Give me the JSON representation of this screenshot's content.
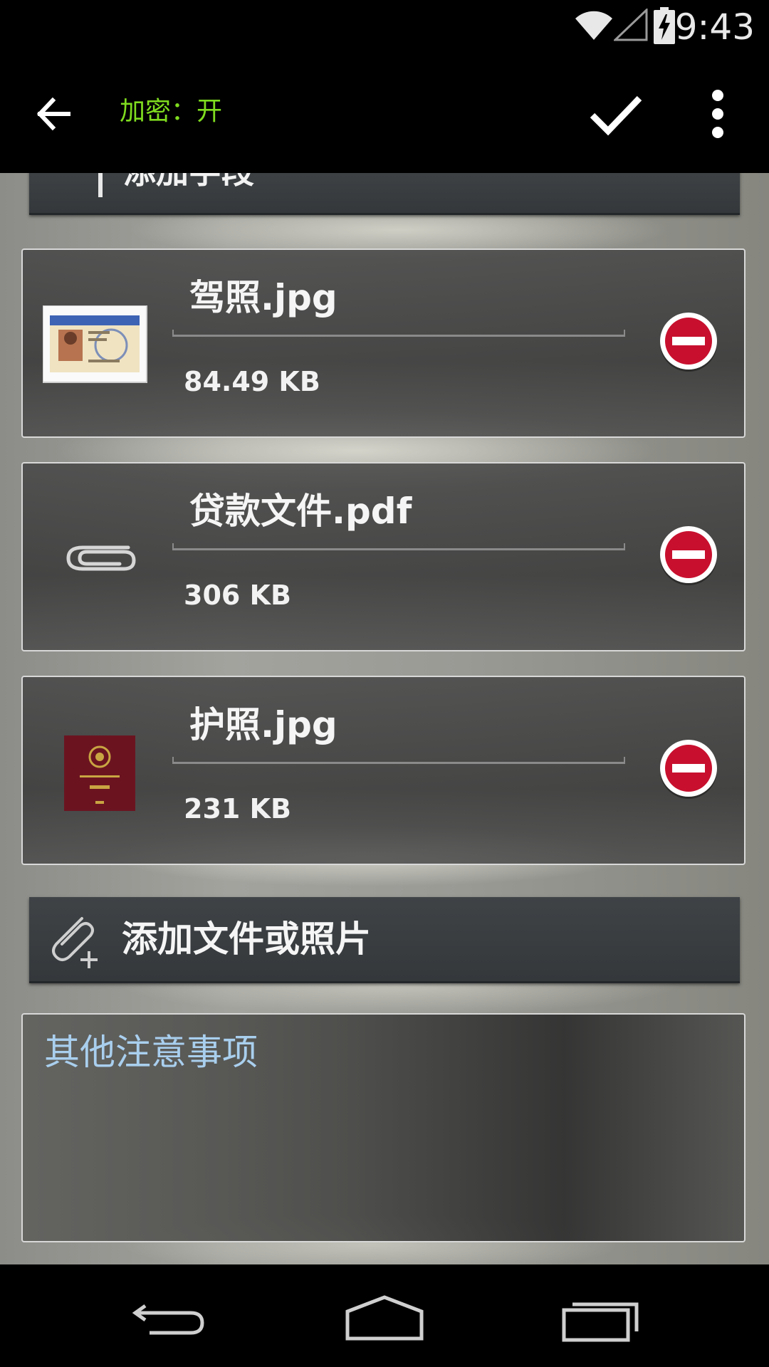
{
  "status_bar": {
    "time": "9:43",
    "icons": [
      "wifi-icon",
      "cell-signal-icon",
      "battery-charging-icon"
    ]
  },
  "action_bar": {
    "encryption_status": "加密：开",
    "icons": [
      "back-arrow-icon",
      "checkmark-icon",
      "overflow-menu-icon"
    ]
  },
  "add_field": {
    "label": "添加字段",
    "icon": "plus-icon"
  },
  "attachments": [
    {
      "name": "驾照.jpg",
      "size": "84.49 KB",
      "thumbnail": "drivers-license-thumbnail"
    },
    {
      "name": "贷款文件.pdf",
      "size": "306 KB",
      "thumbnail": "paperclip-icon"
    },
    {
      "name": "护照.jpg",
      "size": "231 KB",
      "thumbnail": "passport-thumbnail"
    }
  ],
  "add_attachment": {
    "label": "添加文件或照片",
    "icon": "paperclip-plus-icon"
  },
  "notes": {
    "placeholder": "其他注意事项"
  },
  "nav_bar": {
    "icons": [
      "nav-back-icon",
      "nav-home-icon",
      "nav-recents-icon"
    ]
  },
  "colors": {
    "encryption_text": "#7fdc1f",
    "placeholder_text": "#a9cfee",
    "remove_button": "#c8102e"
  }
}
